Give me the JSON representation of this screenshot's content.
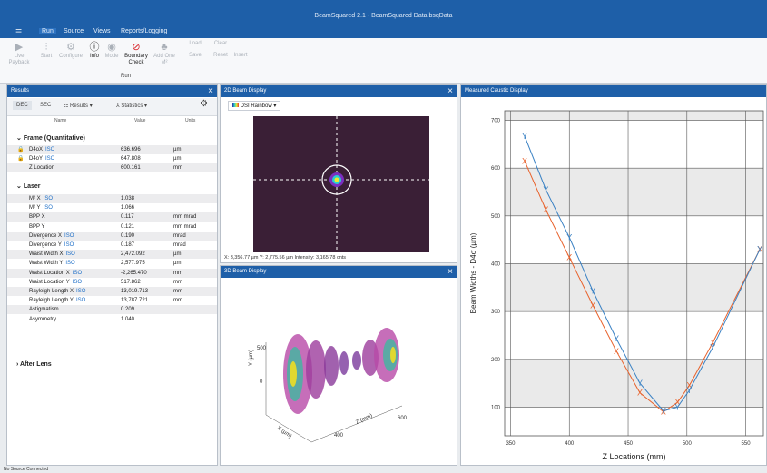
{
  "app": {
    "title": "BeamSquared 2.1 - BeamSquared Data.bsqData"
  },
  "menu": {
    "items": [
      "Run",
      "Source",
      "Views",
      "Reports/Logging"
    ]
  },
  "ribbon": {
    "buttons": [
      "Live Payback",
      "Start",
      "Configure",
      "Info",
      "Mode",
      "Boundary Check",
      "Add One M²",
      "Load",
      "Save",
      "Clear",
      "Reset",
      "Insert"
    ],
    "group": "Run"
  },
  "results": {
    "header": "Results",
    "tabs": [
      "DEC",
      "SEC",
      "Results",
      "Statistics"
    ],
    "columns": [
      "Name",
      "Value",
      "Units"
    ],
    "groups": [
      "Frame (Quantitative)",
      "Laser",
      "After Lens"
    ],
    "frame_rows": [
      {
        "name": "D4oX",
        "iso": "ISO",
        "value": "636.696",
        "unit": "µm"
      },
      {
        "name": "D4oY",
        "iso": "ISO",
        "value": "647.808",
        "unit": "µm"
      },
      {
        "name": "Z Location",
        "iso": "",
        "value": "600.161",
        "unit": "mm"
      }
    ],
    "laser_rows": [
      {
        "name": "M² X",
        "iso": "ISO",
        "value": "1.038",
        "unit": ""
      },
      {
        "name": "M² Y",
        "iso": "ISO",
        "value": "1.066",
        "unit": ""
      },
      {
        "name": "BPP X",
        "iso": "",
        "value": "0.117",
        "unit": "mm mrad"
      },
      {
        "name": "BPP Y",
        "iso": "",
        "value": "0.121",
        "unit": "mm mrad"
      },
      {
        "name": "Divergence X",
        "iso": "ISO",
        "value": "0.190",
        "unit": "mrad"
      },
      {
        "name": "Divergence Y",
        "iso": "ISO",
        "value": "0.187",
        "unit": "mrad"
      },
      {
        "name": "Waist Width X",
        "iso": "ISO",
        "value": "2,472.092",
        "unit": "µm"
      },
      {
        "name": "Waist Width Y",
        "iso": "ISO",
        "value": "2,577.975",
        "unit": "µm"
      },
      {
        "name": "Waist Location X",
        "iso": "ISO",
        "value": "-2,265.470",
        "unit": "mm"
      },
      {
        "name": "Waist Location Y",
        "iso": "ISO",
        "value": "517.862",
        "unit": "mm"
      },
      {
        "name": "Rayleigh Length X",
        "iso": "ISO",
        "value": "13,019.713",
        "unit": "mm"
      },
      {
        "name": "Rayleigh Length Y",
        "iso": "ISO",
        "value": "13,787.721",
        "unit": "mm"
      },
      {
        "name": "Astigmatism",
        "iso": "",
        "value": "0.209",
        "unit": ""
      },
      {
        "name": "Asymmetry",
        "iso": "",
        "value": "1.040",
        "unit": ""
      }
    ]
  },
  "beam2d": {
    "header": "2D Beam Display",
    "palette": "DSI Rainbow",
    "readout": "X: 3,356.77 µm  Y: 2,775.56 µm  Intensity: 3,165.78 cnts"
  },
  "beam3d": {
    "header": "3D Beam Display",
    "axis_labels": {
      "y": "Y (µm)",
      "z": "Z (mm)",
      "x": "X (µm)"
    },
    "ticks": {
      "y": [
        "500",
        "0"
      ],
      "z": [
        "400",
        "600"
      ]
    }
  },
  "caustic": {
    "header": "Measured Caustic Display",
    "xlabel": "Z Locations (mm)",
    "ylabel": "Beam Widths - D4σ (µm)",
    "colors": {
      "x": "#e8622c",
      "y": "#3b82c4",
      "bg": "#eaeaea"
    }
  },
  "chart_data": {
    "type": "scatter",
    "title": "",
    "xlabel": "Z Locations (mm)",
    "ylabel": "Beam Widths - D4σ (µm)",
    "xlim": [
      345,
      565
    ],
    "ylim": [
      40,
      720
    ],
    "x_ticks": [
      350,
      400,
      450,
      500,
      550
    ],
    "y_ticks": [
      100,
      200,
      300,
      400,
      500,
      600,
      700
    ],
    "grid": true,
    "series": [
      {
        "marker": "X",
        "color": "#e8622c",
        "x": [
          362,
          380,
          400,
          420,
          440,
          460,
          480,
          492,
          502,
          522,
          562
        ],
        "y": [
          615,
          513,
          413,
          313,
          217,
          130,
          90,
          110,
          145,
          235,
          430
        ]
      },
      {
        "marker": "Y",
        "color": "#3b82c4",
        "x": [
          362,
          380,
          400,
          420,
          440,
          460,
          480,
          492,
          502,
          522,
          562
        ],
        "y": [
          667,
          555,
          455,
          343,
          243,
          150,
          92,
          100,
          135,
          225,
          430
        ]
      }
    ]
  },
  "status": "No Source Connected"
}
